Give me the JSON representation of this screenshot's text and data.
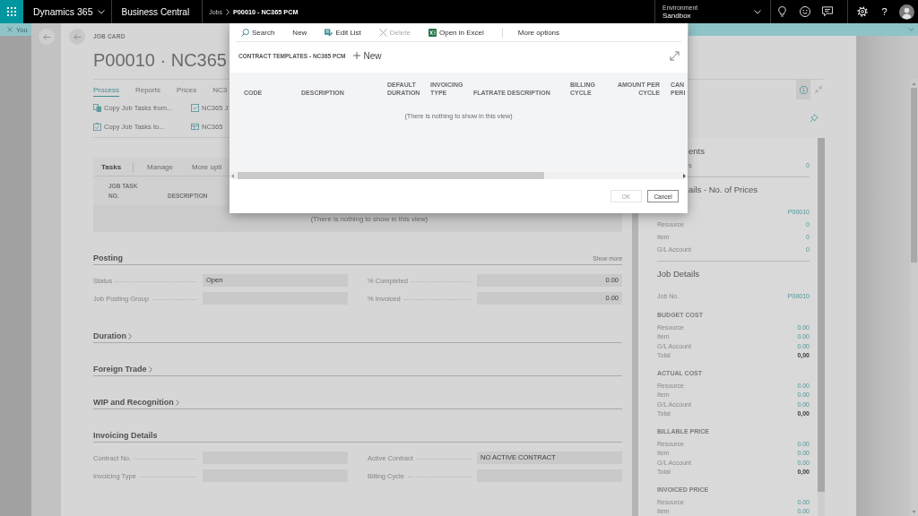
{
  "top_bar": {
    "app_name": "Dynamics 365",
    "product": "Business Central",
    "breadcrumb": [
      "Jobs",
      "P00010 - NC365 PCM"
    ],
    "environment": {
      "label": "Environment",
      "value": "Sandbox"
    },
    "help": "?"
  },
  "notification": {
    "text": "You"
  },
  "job_card": {
    "caption": "JOB CARD",
    "title": "P00010 · NC365",
    "action_tabs": [
      {
        "label": "Process",
        "selected": true
      },
      {
        "label": "Reports",
        "selected": false
      },
      {
        "label": "Prices",
        "selected": false
      },
      {
        "label": "NC3",
        "selected": false
      }
    ],
    "actions": [
      {
        "label": "Copy Job Tasks from...",
        "kind": "copy-from"
      },
      {
        "label": "NC365 J",
        "kind": "checklist"
      },
      {
        "label": "Copy Job Tasks to...",
        "kind": "copy-to"
      },
      {
        "label": "NC365",
        "kind": "table"
      }
    ],
    "tasks": {
      "title": "Tasks",
      "actions": [
        "Manage",
        "More opti"
      ],
      "columns": [
        "JOB TASK NO.",
        "DESCRIPTION"
      ],
      "empty_message": "(There is nothing to show in this view)"
    },
    "sections": [
      {
        "title": "Posting",
        "expanded": true,
        "show_more": "Show more",
        "fields": [
          {
            "label": "Status",
            "value": "Open",
            "kind": "text"
          },
          {
            "label": "% Completed",
            "value": "0.00",
            "kind": "number"
          },
          {
            "label": "Job Posting Group"
          },
          {
            "label": "% Invoiced",
            "value": "0.00",
            "kind": "number"
          }
        ]
      },
      {
        "title": "Duration",
        "expanded": false
      },
      {
        "title": "Foreign Trade",
        "expanded": false
      },
      {
        "title": "WIP and Recognition",
        "expanded": false
      },
      {
        "title": "Invoicing Details",
        "expanded": true,
        "fields": [
          {
            "label": "Contract No."
          },
          {
            "label": "Active Contract",
            "value": "NO ACTIVE CONTRACT",
            "kind": "text"
          },
          {
            "label": "Invoicing Type"
          },
          {
            "label": "Billing Cycle"
          }
        ]
      }
    ]
  },
  "factbox": {
    "parts": [
      {
        "title": "ents",
        "rows": [
          {
            "label": "s",
            "value": "0"
          }
        ]
      },
      {
        "title": "ails - No. of Prices",
        "rows": [
          {
            "value": "P00010"
          },
          {
            "label": "Resource",
            "value": "0"
          },
          {
            "label": "Item",
            "value": "0"
          },
          {
            "label": "G/L Account",
            "value": "0"
          }
        ]
      },
      {
        "title": "Job Details",
        "rows": [
          {
            "label": "Job No.",
            "value": "P00010"
          }
        ],
        "groups": [
          {
            "title": "BUDGET COST",
            "rows": [
              {
                "label": "Resource",
                "value": "0.00",
                "total": false
              },
              {
                "label": "Item",
                "value": "0.00",
                "total": false
              },
              {
                "label": "G/L Account",
                "value": "0.00",
                "total": false
              },
              {
                "label": "Total",
                "value": "0,00",
                "total": true
              }
            ]
          },
          {
            "title": "ACTUAL COST",
            "rows": [
              {
                "label": "Resource",
                "value": "0.00",
                "total": false
              },
              {
                "label": "Item",
                "value": "0.00",
                "total": false
              },
              {
                "label": "G/L Account",
                "value": "0.00",
                "total": false
              },
              {
                "label": "Total",
                "value": "0,00",
                "total": true
              }
            ]
          },
          {
            "title": "BILLABLE PRICE",
            "rows": [
              {
                "label": "Resource",
                "value": "0.00",
                "total": false
              },
              {
                "label": "Item",
                "value": "0.00",
                "total": false
              },
              {
                "label": "G/L Account",
                "value": "0.00",
                "total": false
              },
              {
                "label": "Total",
                "value": "0,00",
                "total": true
              }
            ]
          },
          {
            "title": "INVOICED PRICE",
            "rows": [
              {
                "label": "Resource",
                "value": "0.00",
                "total": false
              },
              {
                "label": "Item",
                "value": "0.00",
                "total": false
              }
            ]
          }
        ]
      }
    ]
  },
  "dialog": {
    "toolbar": [
      {
        "label": "Search",
        "kind": "search",
        "disabled": false
      },
      {
        "label": "New",
        "kind": "new",
        "disabled": false
      },
      {
        "label": "Edit List",
        "kind": "edit-list",
        "disabled": false
      },
      {
        "label": "Delete",
        "kind": "delete",
        "disabled": true
      },
      {
        "label": "Open in Excel",
        "kind": "excel",
        "disabled": false
      },
      {
        "label": "More options",
        "kind": "more",
        "disabled": false
      }
    ],
    "title": "CONTRACT TEMPLATES - NC365 PCM",
    "new_action": "New",
    "columns": [
      {
        "label": "CODE",
        "kind": "text"
      },
      {
        "label": "DESCRIPTION",
        "kind": "text"
      },
      {
        "label": "DEFAULT DURATION",
        "kind": "text"
      },
      {
        "label": "INVOICING TYPE",
        "kind": "text"
      },
      {
        "label": "FLATRATE DESCRIPTION",
        "kind": "text"
      },
      {
        "label": "BILLING CYCLE",
        "kind": "text"
      },
      {
        "label": "AMOUNT PER CYCLE",
        "kind": "number"
      },
      {
        "label": "CAN PERI",
        "kind": "text"
      }
    ],
    "empty_message": "(There is nothing to show in this view)",
    "buttons": [
      {
        "label": "OK",
        "disabled": true
      },
      {
        "label": "Cancel",
        "disabled": false
      }
    ]
  }
}
